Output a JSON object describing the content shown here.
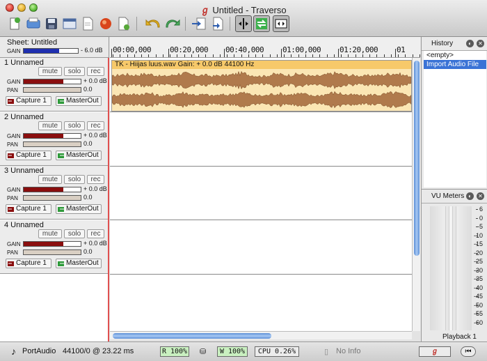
{
  "window": {
    "title": "Untitled - Traverso",
    "logo_icon": "traverso-logo-icon"
  },
  "toolbar": {
    "buttons": [
      "new-project-icon",
      "open-icon",
      "save-icon",
      "settings-icon",
      "document-icon",
      "record-icon",
      "export-icon",
      "undo-icon",
      "redo-icon",
      "import-icon",
      "clip-icon",
      "snap-icon",
      "follow-icon",
      "zoom-fit-icon"
    ]
  },
  "sheet": {
    "title": "Sheet: Untitled",
    "gain_label": "GAIN",
    "gain_value": "- 6.0 dB",
    "gain_level": 0.65
  },
  "ruler": {
    "labels": [
      "00:00,000",
      "00:20,000",
      "00:40,000",
      "01:00,000",
      "01:20,000",
      "01"
    ]
  },
  "tracks": [
    {
      "name": "1 Unnamed",
      "mute": "mute",
      "solo": "solo",
      "rec": "rec",
      "gain_label": "GAIN",
      "gain_value": "+ 0.0 dB",
      "pan_label": "PAN",
      "pan_value": "0.0",
      "input": "Capture 1",
      "output": "MasterOut",
      "gain_level": 0.69
    },
    {
      "name": "2 Unnamed",
      "mute": "mute",
      "solo": "solo",
      "rec": "rec",
      "gain_label": "GAIN",
      "gain_value": "+ 0.0 dB",
      "pan_label": "PAN",
      "pan_value": "0.0",
      "input": "Capture 1",
      "output": "MasterOut",
      "gain_level": 0.69
    },
    {
      "name": "3 Unnamed",
      "mute": "mute",
      "solo": "solo",
      "rec": "rec",
      "gain_label": "GAIN",
      "gain_value": "+ 0.0 dB",
      "pan_label": "PAN",
      "pan_value": "0.0",
      "input": "Capture 1",
      "output": "MasterOut",
      "gain_level": 0.69
    },
    {
      "name": "4 Unnamed",
      "mute": "mute",
      "solo": "solo",
      "rec": "rec",
      "gain_label": "GAIN",
      "gain_value": "+ 0.0 dB",
      "pan_label": "PAN",
      "pan_value": "0.0",
      "input": "Capture 1",
      "output": "MasterOut",
      "gain_level": 0.69
    }
  ],
  "clip": {
    "label": "TK - Hiijas luus.wav    Gain: + 0.0 dB    44100 Hz",
    "waveform_color": "#b07a4c",
    "background_color": "#fbe6b4"
  },
  "history": {
    "title": "History",
    "items": [
      "<empty>",
      "Import Audio File"
    ]
  },
  "vu": {
    "title": "VU Meters",
    "scale": [
      "6",
      "0",
      "-5",
      "-10",
      "-15",
      "-20",
      "-25",
      "-30",
      "-35",
      "-40",
      "-45",
      "-50",
      "-55",
      "-60"
    ],
    "label": "Playback 1"
  },
  "status": {
    "driver": "PortAudio",
    "rate": "44100/0 @ 23.22 ms",
    "read": "R 100%",
    "write": "W 100%",
    "cpu": "CPU 0.26%",
    "info": "No Info"
  }
}
